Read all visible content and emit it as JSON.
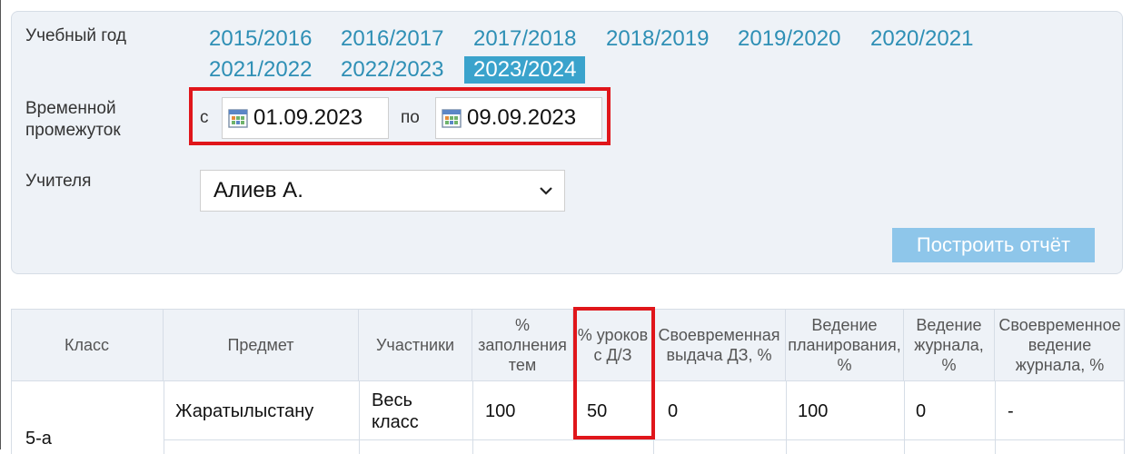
{
  "filters": {
    "year_label": "Учебный год",
    "years": [
      "2015/2016",
      "2016/2017",
      "2017/2018",
      "2018/2019",
      "2019/2020",
      "2020/2021",
      "2021/2022",
      "2022/2023",
      "2023/2024"
    ],
    "active_year": "2023/2024",
    "period_label": "Временной промежуток",
    "from_prefix": "с",
    "from_date": "01.09.2023",
    "to_prefix": "по",
    "to_date": "09.09.2023",
    "teacher_label": "Учителя",
    "teacher_value": "Алиев А.",
    "build_button": "Построить отчёт"
  },
  "table": {
    "headers": [
      "Класс",
      "Предмет",
      "Участники",
      "% заполнения тем",
      "% уроков с Д/З",
      "Своевременная выдача ДЗ, %",
      "Ведение планирования, %",
      "Ведение журнала, %",
      "Своевременное ведение журнала, %"
    ],
    "rows": [
      {
        "class": "5-а",
        "subject": "Жаратылыстану",
        "participants": "Весь класс",
        "fill_pct": "100",
        "hw_pct": "50",
        "timely_hw": "0",
        "planning": "100",
        "journal": "0",
        "timely_journal": "-"
      }
    ]
  },
  "colors": {
    "link": "#2e8fb5",
    "active_year_bg": "#3aa3cc",
    "button_bg": "#8ec6ea",
    "highlight": "#e0161b",
    "panel_bg": "#eef2f7"
  },
  "icons": {
    "date": "calendar-icon",
    "select": "chevron-down-icon"
  }
}
